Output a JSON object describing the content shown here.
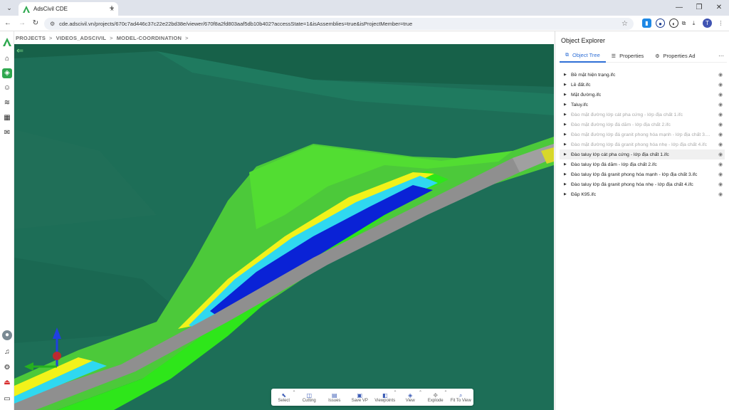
{
  "browser": {
    "tab_title": "AdsCivil CDE",
    "tab_close": "×",
    "new_tab": "+",
    "url": "cde.adscivil.vn/projects/670c7ad446c37c22e22bd38e/viewer/670f8a2fd803aaf5db10b402?accessState=1&isAssemblies=true&isProjectMember=true",
    "profile_initial": "T",
    "window_minimize": "—",
    "window_restore": "❐",
    "window_close": "✕"
  },
  "breadcrumb": {
    "items": [
      "PROJECTS",
      "VIDEOS_ADSCIVIL",
      "MODEL-COORDINATION"
    ],
    "separator": ">"
  },
  "toolbar": {
    "tools": [
      {
        "label": "Select",
        "icon": "cursor-icon",
        "glyph": "⬉",
        "caret": true
      },
      {
        "label": "Cutting",
        "icon": "cube-cut-icon",
        "glyph": "◫",
        "caret": false
      },
      {
        "label": "Issues",
        "icon": "issues-icon",
        "glyph": "▤",
        "caret": false
      },
      {
        "label": "Save VP",
        "icon": "save-viewpoint-icon",
        "glyph": "▣",
        "caret": false
      },
      {
        "label": "Viewpoints",
        "icon": "viewpoints-icon",
        "glyph": "◧",
        "caret": true
      },
      {
        "label": "View",
        "icon": "view-cube-icon",
        "glyph": "◈",
        "caret": true
      },
      {
        "label": "Explode",
        "icon": "explode-icon",
        "glyph": "✥",
        "caret": true
      },
      {
        "label": "Fit To View",
        "icon": "fit-to-view-icon",
        "glyph": "⌕",
        "caret": false
      }
    ]
  },
  "explorer": {
    "title": "Object Explorer",
    "tabs": [
      {
        "label": "Object Tree",
        "icon": "tree-icon",
        "glyph": "⧉",
        "active": true
      },
      {
        "label": "Properties",
        "icon": "list-icon",
        "glyph": "☰",
        "active": false
      },
      {
        "label": "Properties Ad",
        "icon": "properties-advanced-icon",
        "glyph": "⚙",
        "active": false
      }
    ],
    "more": "⋯",
    "items": [
      {
        "name": "Bề mặt hiện trạng.ifc",
        "dim": false,
        "hl": false
      },
      {
        "name": "Lề đất.ifc",
        "dim": false,
        "hl": false
      },
      {
        "name": "Mặt đường.ifc",
        "dim": false,
        "hl": false
      },
      {
        "name": "Taluy.ifc",
        "dim": false,
        "hl": false
      },
      {
        "name": "Đào mặt đường lớp cát pha cứng - lớp địa chất 1.ifc",
        "dim": true,
        "hl": false
      },
      {
        "name": "Đào mặt đường lớp đá dăm - lớp địa chất 2.ifc",
        "dim": true,
        "hl": false
      },
      {
        "name": "Đào mặt đường lớp đá granit phong hóa mạnh - lớp địa chất 3....",
        "dim": true,
        "hl": false
      },
      {
        "name": "Đào mặt đường lớp đá granit phong hóa nhẹ - lớp địa chất 4.ifc",
        "dim": true,
        "hl": false
      },
      {
        "name": "Đào taluy lớp cát pha cứng - lớp địa chất 1.ifc",
        "dim": false,
        "hl": true
      },
      {
        "name": "Đào taluy lớp đá dăm - lớp địa chất 2.ifc",
        "dim": false,
        "hl": false
      },
      {
        "name": "Đào taluy lớp đá granit phong hóa mạnh - lớp địa chất 3.ifc",
        "dim": false,
        "hl": false
      },
      {
        "name": "Đào taluy lớp đá granit phong hóa nhẹ - lớp địa chất 4.ifc",
        "dim": false,
        "hl": false
      },
      {
        "name": "Đắp K95.ifc",
        "dim": false,
        "hl": false
      }
    ]
  },
  "colors": {
    "viewport_bg": "#1b6b55",
    "terrain_light": "#4ccf3a",
    "terrain_bright": "#33e51d",
    "road_gray": "#8f8f8f",
    "layer_yellow": "#f2f21a",
    "layer_cyan": "#2fd8f0",
    "layer_blue": "#0a22d6",
    "accent": "#2f6fd6"
  }
}
